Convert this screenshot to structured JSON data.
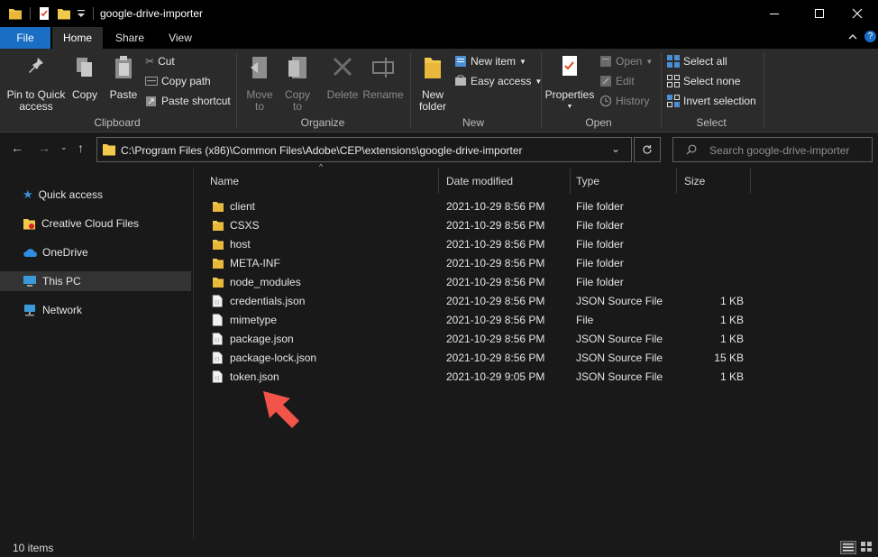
{
  "window": {
    "title": "google-drive-importer",
    "controls": [
      "minimize",
      "maximize",
      "close"
    ]
  },
  "ribbon_tabs": [
    "File",
    "Home",
    "Share",
    "View"
  ],
  "ribbon": {
    "clipboard": {
      "label": "Clipboard",
      "pin": "Pin to Quick access",
      "copy": "Copy",
      "paste": "Paste",
      "cut": "Cut",
      "copy_path": "Copy path",
      "paste_shortcut": "Paste shortcut"
    },
    "organize": {
      "label": "Organize",
      "move_to": "Move to",
      "copy_to": "Copy to",
      "delete": "Delete",
      "rename": "Rename"
    },
    "new": {
      "label": "New",
      "new_folder": "New folder",
      "new_item": "New item",
      "easy_access": "Easy access"
    },
    "open": {
      "label": "Open",
      "properties": "Properties",
      "open": "Open",
      "edit": "Edit",
      "history": "History"
    },
    "select": {
      "label": "Select",
      "select_all": "Select all",
      "select_none": "Select none",
      "invert_selection": "Invert selection"
    }
  },
  "address": {
    "path": "C:\\Program Files (x86)\\Common Files\\Adobe\\CEP\\extensions\\google-drive-importer",
    "search_placeholder": "Search google-drive-importer"
  },
  "nav_pane": [
    {
      "label": "Quick access",
      "icon": "star-icon"
    },
    {
      "label": "Creative Cloud Files",
      "icon": "creative-cloud-icon"
    },
    {
      "label": "OneDrive",
      "icon": "cloud-icon"
    },
    {
      "label": "This PC",
      "icon": "computer-icon",
      "selected": true
    },
    {
      "label": "Network",
      "icon": "network-icon"
    }
  ],
  "columns": {
    "name": "Name",
    "date": "Date modified",
    "type": "Type",
    "size": "Size"
  },
  "files": [
    {
      "name": "client",
      "date": "2021-10-29 8:56 PM",
      "type": "File folder",
      "size": "",
      "kind": "folder"
    },
    {
      "name": "CSXS",
      "date": "2021-10-29 8:56 PM",
      "type": "File folder",
      "size": "",
      "kind": "folder"
    },
    {
      "name": "host",
      "date": "2021-10-29 8:56 PM",
      "type": "File folder",
      "size": "",
      "kind": "folder"
    },
    {
      "name": "META-INF",
      "date": "2021-10-29 8:56 PM",
      "type": "File folder",
      "size": "",
      "kind": "folder"
    },
    {
      "name": "node_modules",
      "date": "2021-10-29 8:56 PM",
      "type": "File folder",
      "size": "",
      "kind": "folder"
    },
    {
      "name": "credentials.json",
      "date": "2021-10-29 8:56 PM",
      "type": "JSON Source File",
      "size": "1 KB",
      "kind": "json"
    },
    {
      "name": "mimetype",
      "date": "2021-10-29 8:56 PM",
      "type": "File",
      "size": "1 KB",
      "kind": "file"
    },
    {
      "name": "package.json",
      "date": "2021-10-29 8:56 PM",
      "type": "JSON Source File",
      "size": "1 KB",
      "kind": "json"
    },
    {
      "name": "package-lock.json",
      "date": "2021-10-29 8:56 PM",
      "type": "JSON Source File",
      "size": "15 KB",
      "kind": "json"
    },
    {
      "name": "token.json",
      "date": "2021-10-29 9:05 PM",
      "type": "JSON Source File",
      "size": "1 KB",
      "kind": "json"
    }
  ],
  "status": {
    "items_count": "10 items"
  },
  "colors": {
    "accent": "#1a6ec4",
    "folder": "#f2c94c",
    "annotation_arrow": "#f2544a"
  }
}
